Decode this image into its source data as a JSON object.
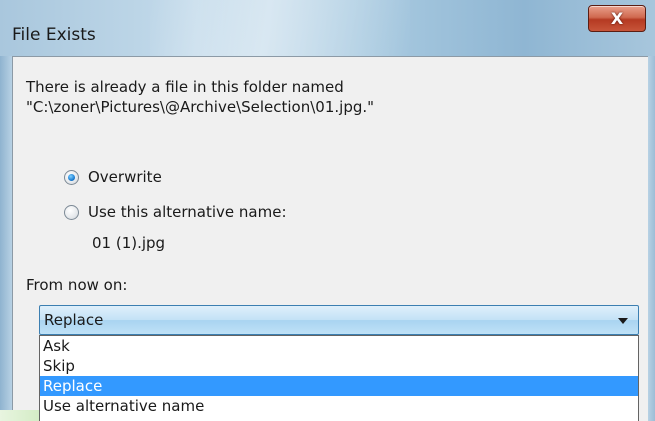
{
  "window": {
    "title": "File Exists",
    "close_glyph": "X"
  },
  "message": {
    "line1": "There is already a file in this folder named",
    "line2": "\"C:\\zoner\\Pictures\\@Archive\\Selection\\01.jpg.\""
  },
  "options": {
    "overwrite": {
      "label": "Overwrite",
      "checked": true
    },
    "alternative": {
      "label": "Use this alternative name:",
      "checked": false
    },
    "alternative_name": "01 (1).jpg"
  },
  "from_now_on": {
    "label": "From now on:",
    "selected": "Replace",
    "items": [
      "Ask",
      "Skip",
      "Replace",
      "Use alternative name"
    ]
  }
}
